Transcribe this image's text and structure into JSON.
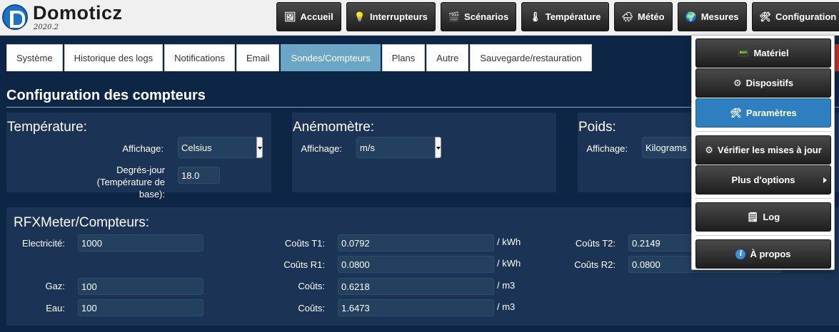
{
  "app": {
    "name": "Domoticz",
    "version": "2020.2"
  },
  "nav": [
    {
      "label": "Accueil",
      "icon": "🖼",
      "name": "nav-accueil",
      "icon_name": "home-icon"
    },
    {
      "label": "Interrupteurs",
      "icon": "💡",
      "name": "nav-interrupteurs",
      "icon_name": "bulb-icon"
    },
    {
      "label": "Scénarios",
      "icon": "🎬",
      "name": "nav-scenarios",
      "icon_name": "clapper-icon"
    },
    {
      "label": "Température",
      "icon": "🌡",
      "name": "nav-temperature",
      "icon_name": "thermometer-icon"
    },
    {
      "label": "Météo",
      "icon": "🌧",
      "name": "nav-meteo",
      "icon_name": "weather-icon"
    },
    {
      "label": "Mesures",
      "icon": "🌍",
      "name": "nav-mesures",
      "icon_name": "globe-icon"
    },
    {
      "label": "Configuration",
      "icon": "🛠",
      "name": "nav-configuration",
      "icon_name": "tools-icon"
    }
  ],
  "tabs": [
    {
      "label": "Système"
    },
    {
      "label": "Historique des logs"
    },
    {
      "label": "Notifications"
    },
    {
      "label": "Email"
    },
    {
      "label": "Sondes/Compteurs",
      "active": true
    },
    {
      "label": "Plans"
    },
    {
      "label": "Autre"
    },
    {
      "label": "Sauvegarde/restauration"
    }
  ],
  "page_title": "Configuration des compteurs",
  "temperature": {
    "title": "Température:",
    "display_label": "Affichage:",
    "display_value": "Celsius",
    "degree_days_label": "Degrés-jour (Température de base):",
    "degree_days_value": "18.0"
  },
  "wind": {
    "title": "Anémomètre:",
    "display_label": "Affichage:",
    "display_value": "m/s"
  },
  "weight": {
    "title": "Poids:",
    "display_label": "Affichage:",
    "display_value": "Kilograms"
  },
  "rfx": {
    "title": "RFXMeter/Compteurs:",
    "electricity_label": "Electricité:",
    "electricity_value": "1000",
    "gas_label": "Gaz:",
    "gas_value": "100",
    "water_label": "Eau:",
    "water_value": "100",
    "t1_label": "Coûts T1:",
    "t1_value": "0.0792",
    "t1_unit": "/ kWh",
    "r1_label": "Coûts R1:",
    "r1_value": "0.0800",
    "r1_unit": "/ kWh",
    "gas_cost_label": "Coûts:",
    "gas_cost_value": "0.6218",
    "gas_cost_unit": "/ m3",
    "water_cost_label": "Coûts:",
    "water_cost_value": "1.6473",
    "water_cost_unit": "/ m3",
    "t2_label": "Coûts T2:",
    "t2_value": "0.2149",
    "r2_label": "Coûts R2:",
    "r2_value": "0.0800"
  },
  "menu": {
    "hardware": "Matériel",
    "devices": "Dispositifs",
    "settings": "Paramètres",
    "check_updates": "Vérifier les mises à jour",
    "more_options": "Plus d'options",
    "log": "Log",
    "about": "À propos"
  }
}
